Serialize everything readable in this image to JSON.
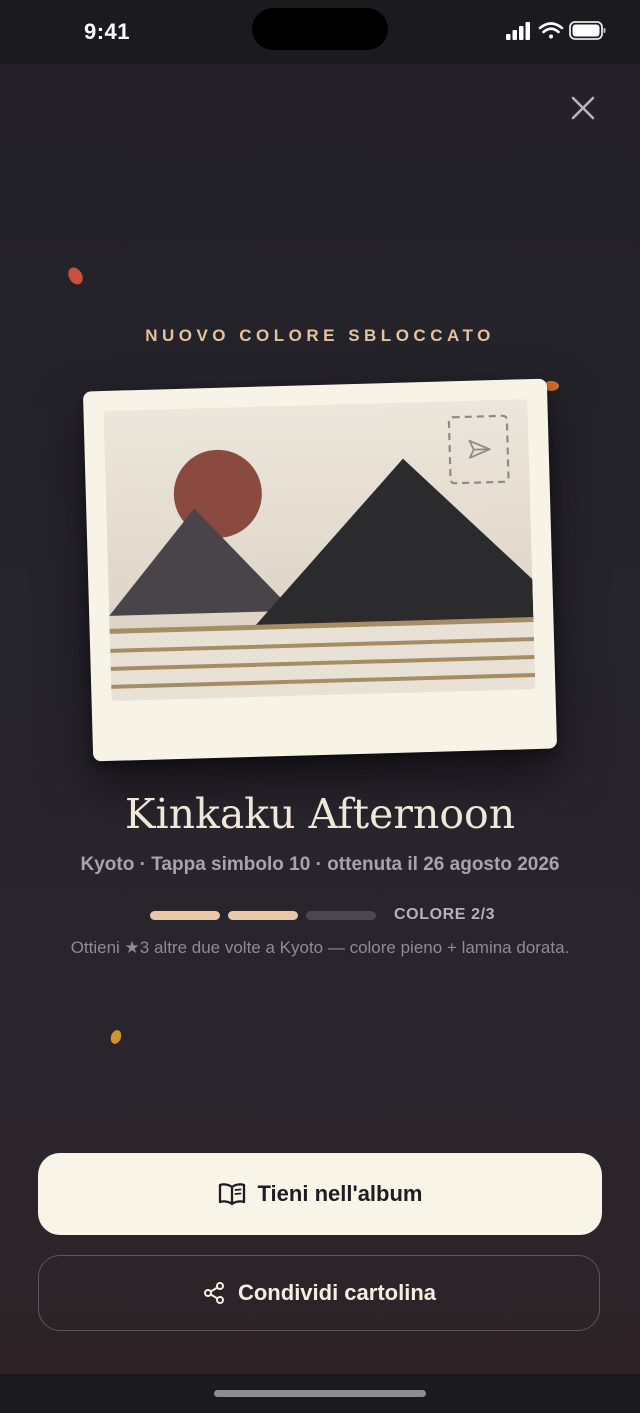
{
  "status_bar": {
    "time": "9:41"
  },
  "header": {
    "close_icon": "close-icon"
  },
  "reward": {
    "eyebrow": "NUOVO COLORE SBLOCCATO",
    "postcard_icon": "paper-plane-icon",
    "title": "Kinkaku Afternoon",
    "meta": "Kyoto · Tappa simbolo 10 · ottenuta il 26 agosto 2026",
    "progress": {
      "filled": 2,
      "total": 3,
      "label": "COLORE 2/3"
    },
    "hint": "Ottieni ★3 altre due volte a Kyoto — colore pieno + lamina dorata."
  },
  "actions": {
    "keep": {
      "label": "Tieni nell'album",
      "icon": "open-book-icon"
    },
    "share": {
      "label": "Condividi cartolina",
      "icon": "share-icon"
    }
  },
  "colors": {
    "background": "#242228",
    "accent": "#e6c19c",
    "card": "#f7f3e6",
    "sun": "#8a4a40",
    "mountain_back": "#48444a",
    "mountain_front": "#2b2b2d",
    "stripes": "#a58e66"
  }
}
